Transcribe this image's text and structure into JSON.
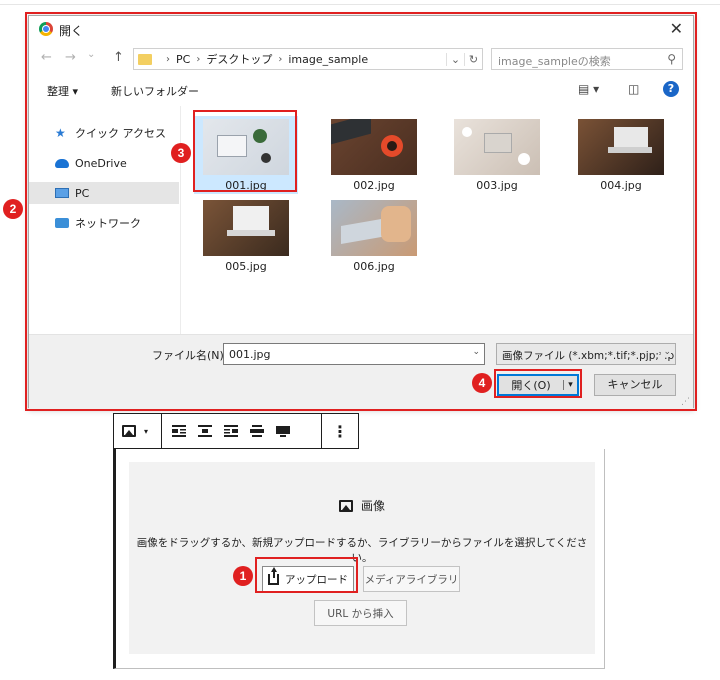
{
  "dialog": {
    "title": "開く",
    "close_symbol": "✕",
    "nav": {
      "back_symbol": "←",
      "forward_symbol": "→",
      "recent_symbol": "⌄",
      "up_symbol": "↑",
      "breadcrumbs": [
        "PC",
        "デスクトップ",
        "image_sample"
      ],
      "separator": "›",
      "dropdown_symbol": "⌄",
      "refresh_symbol": "↻"
    },
    "search": {
      "placeholder": "image_sampleの検索",
      "icon_symbol": "⚲"
    },
    "toolbar": {
      "organize_label": "整理 ▾",
      "new_folder_label": "新しいフォルダー",
      "view_symbol": "▤ ▾",
      "preview_symbol": "◫",
      "help_symbol": "?"
    },
    "nav_pane": [
      {
        "label": "クイック アクセス",
        "icon": "star-icon",
        "selected": false
      },
      {
        "label": "OneDrive",
        "icon": "cloud-icon",
        "selected": false
      },
      {
        "label": "PC",
        "icon": "computer-icon",
        "selected": true
      },
      {
        "label": "ネットワーク",
        "icon": "network-icon",
        "selected": false
      }
    ],
    "files": [
      {
        "name": "001.jpg",
        "selected": true
      },
      {
        "name": "002.jpg",
        "selected": false
      },
      {
        "name": "003.jpg",
        "selected": false
      },
      {
        "name": "004.jpg",
        "selected": false
      },
      {
        "name": "005.jpg",
        "selected": false
      },
      {
        "name": "006.jpg",
        "selected": false
      }
    ],
    "filename_label": "ファイル名(N):",
    "filename_value": "001.jpg",
    "filename_dropdown_symbol": "⌄",
    "filetype_value": "画像ファイル (*.xbm;*.tif;*.pjp;*.p",
    "filetype_dropdown_symbol": "⌄",
    "open_button": "開く(O)",
    "open_dropdown_symbol": "▾",
    "cancel_button": "キャンセル",
    "grip_symbol": "⋰"
  },
  "wp_block": {
    "toolbar": {
      "image_icon": "image-icon",
      "dropdown_symbol": "▾",
      "align_buttons": [
        "align-left-icon",
        "align-center-icon",
        "align-right-icon",
        "align-wide-icon",
        "align-full-icon"
      ],
      "more_symbol": "⋮"
    },
    "title": "画像",
    "instructions": "画像をドラッグするか、新規アップロードするか、ライブラリーからファイルを選択してください。",
    "upload_label": "アップロード",
    "media_library_label": "メディアライブラリ",
    "url_label": "URL から挿入"
  },
  "annotations": {
    "badges": [
      "1",
      "2",
      "3",
      "4"
    ],
    "highlight_color": "#e02020"
  },
  "colors": {
    "accent_blue": "#0078d7",
    "selection_blue": "#cce8ff",
    "annotation_red": "#e02020"
  }
}
